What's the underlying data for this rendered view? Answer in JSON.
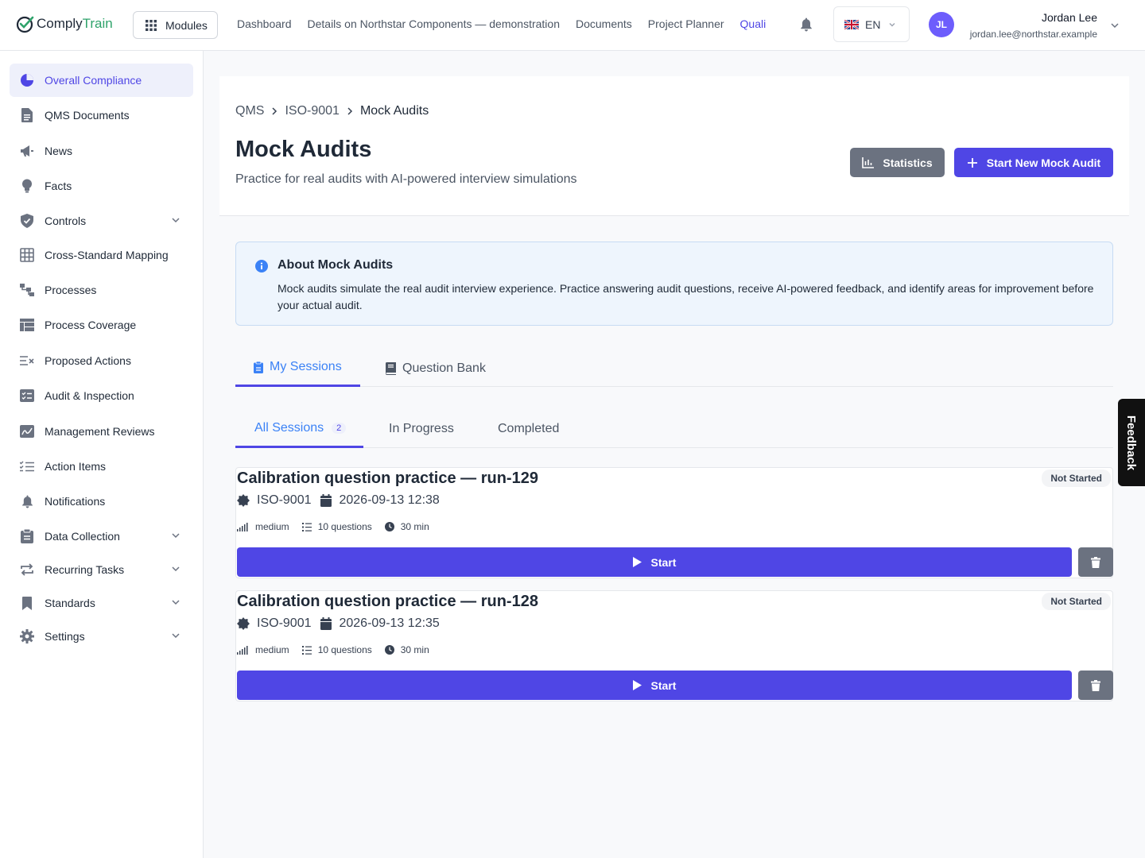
{
  "app": {
    "logo_part1": "Comply",
    "logo_part2": "Train",
    "modules_label": "Modules"
  },
  "topnav": [
    {
      "label": "Dashboard"
    },
    {
      "label": "Details on Northstar Components — demonstration"
    },
    {
      "label": "Documents"
    },
    {
      "label": "Project Planner"
    },
    {
      "label": "Quali"
    }
  ],
  "language": {
    "code": "EN"
  },
  "user": {
    "initials": "JL",
    "name": "Jordan Lee",
    "email": "jordan.lee@northstar.example"
  },
  "sidebar": {
    "items": [
      {
        "label": "Overall Compliance",
        "icon": "pie-chart-icon",
        "active": true
      },
      {
        "label": "QMS Documents",
        "icon": "document-icon"
      },
      {
        "label": "News",
        "icon": "megaphone-icon"
      },
      {
        "label": "Facts",
        "icon": "lightbulb-icon"
      },
      {
        "label": "Controls",
        "icon": "shield-check-icon",
        "expandable": true
      },
      {
        "label": "Cross-Standard Mapping",
        "icon": "grid-icon"
      },
      {
        "label": "Processes",
        "icon": "hierarchy-icon"
      },
      {
        "label": "Process Coverage",
        "icon": "table-icon"
      },
      {
        "label": "Proposed Actions",
        "icon": "list-x-icon"
      },
      {
        "label": "Audit & Inspection",
        "icon": "checklist-box-icon"
      },
      {
        "label": "Management Reviews",
        "icon": "signature-icon"
      },
      {
        "label": "Action Items",
        "icon": "checklist-icon"
      },
      {
        "label": "Notifications",
        "icon": "bell-icon"
      },
      {
        "label": "Data Collection",
        "icon": "clipboard-icon",
        "expandable": true
      },
      {
        "label": "Recurring Tasks",
        "icon": "repeat-icon",
        "expandable": true
      },
      {
        "label": "Standards",
        "icon": "bookmark-icon",
        "expandable": true
      },
      {
        "label": "Settings",
        "icon": "gear-icon",
        "expandable": true
      }
    ]
  },
  "breadcrumb": [
    "QMS",
    "ISO-9001",
    "Mock Audits"
  ],
  "page": {
    "title": "Mock Audits",
    "subtitle": "Practice for real audits with AI-powered interview simulations",
    "statistics_label": "Statistics",
    "new_audit_label": "Start New Mock Audit"
  },
  "info": {
    "title": "About Mock Audits",
    "text": "Mock audits simulate the real audit interview experience. Practice answering audit questions, receive AI-powered feedback, and identify areas for improvement before your actual audit."
  },
  "tabs": [
    {
      "label": "My Sessions",
      "active": true
    },
    {
      "label": "Question Bank"
    }
  ],
  "subtabs": [
    {
      "label": "All Sessions",
      "count": "2",
      "active": true
    },
    {
      "label": "In Progress"
    },
    {
      "label": "Completed"
    }
  ],
  "sessions": [
    {
      "title": "Calibration question practice — run-129",
      "status": "Not Started",
      "standard": "ISO-9001",
      "datetime": "2026-09-13 12:38",
      "difficulty": "medium",
      "questions": "10 questions",
      "duration": "30 min",
      "start_label": "Start"
    },
    {
      "title": "Calibration question practice — run-128",
      "status": "Not Started",
      "standard": "ISO-9001",
      "datetime": "2026-09-13 12:35",
      "difficulty": "medium",
      "questions": "10 questions",
      "duration": "30 min",
      "start_label": "Start"
    }
  ],
  "feedback_label": "Feedback",
  "colors": {
    "accent": "#4f46e5",
    "brand_green": "#2fa36b",
    "secondary_button": "#6b7280",
    "info_bg": "#eef5fd"
  }
}
